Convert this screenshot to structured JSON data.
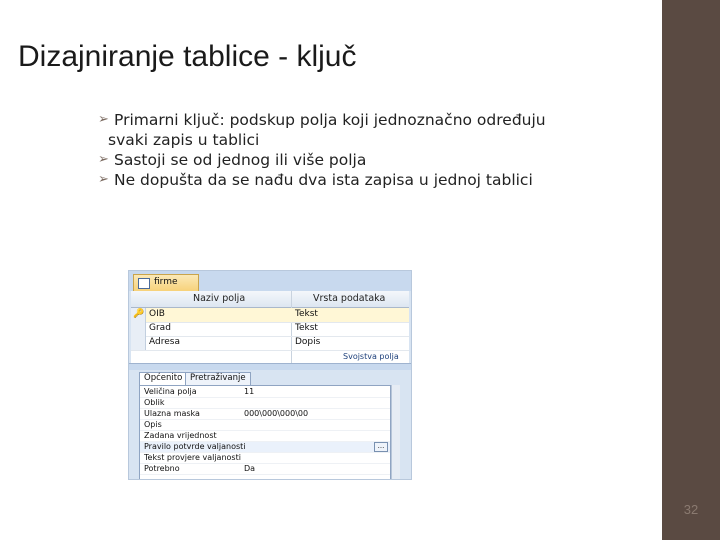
{
  "slide": {
    "title": "Dizajniranje tablice - ključ",
    "bullets": [
      {
        "line1": "Primarni ključ: podskup polja koji jednoznačno određuju",
        "line2": "svaki zapis u tablici"
      },
      {
        "line1": "Sastoji se od jednog ili više polja"
      },
      {
        "line1": "Ne dopušta da se nađu dva ista zapisa u jednoj tablici"
      }
    ],
    "page_number": "32",
    "bullet_glyph": "➢"
  },
  "access": {
    "tab_name": "firme",
    "columns": [
      "Naziv polja",
      "Vrsta podataka"
    ],
    "rows": [
      {
        "name": "OIB",
        "type": "Tekst",
        "key": true
      },
      {
        "name": "Grad",
        "type": "Tekst",
        "key": false
      },
      {
        "name": "Adresa",
        "type": "Dopis",
        "key": false
      }
    ],
    "props_label": "Svojstva polja",
    "prop_tabs": [
      "Općenito",
      "Pretraživanje"
    ],
    "properties": [
      {
        "label": "Veličina polja",
        "value": "11"
      },
      {
        "label": "Oblik",
        "value": ""
      },
      {
        "label": "Ulazna maska",
        "value": "000\\000\\000\\00"
      },
      {
        "label": "Opis",
        "value": ""
      },
      {
        "label": "Zadana vrijednost",
        "value": ""
      },
      {
        "label": "Pravilo potvrde valjanosti",
        "value": ""
      },
      {
        "label": "Tekst provjere valjanosti",
        "value": ""
      },
      {
        "label": "Potrebno",
        "value": "Da"
      }
    ]
  }
}
